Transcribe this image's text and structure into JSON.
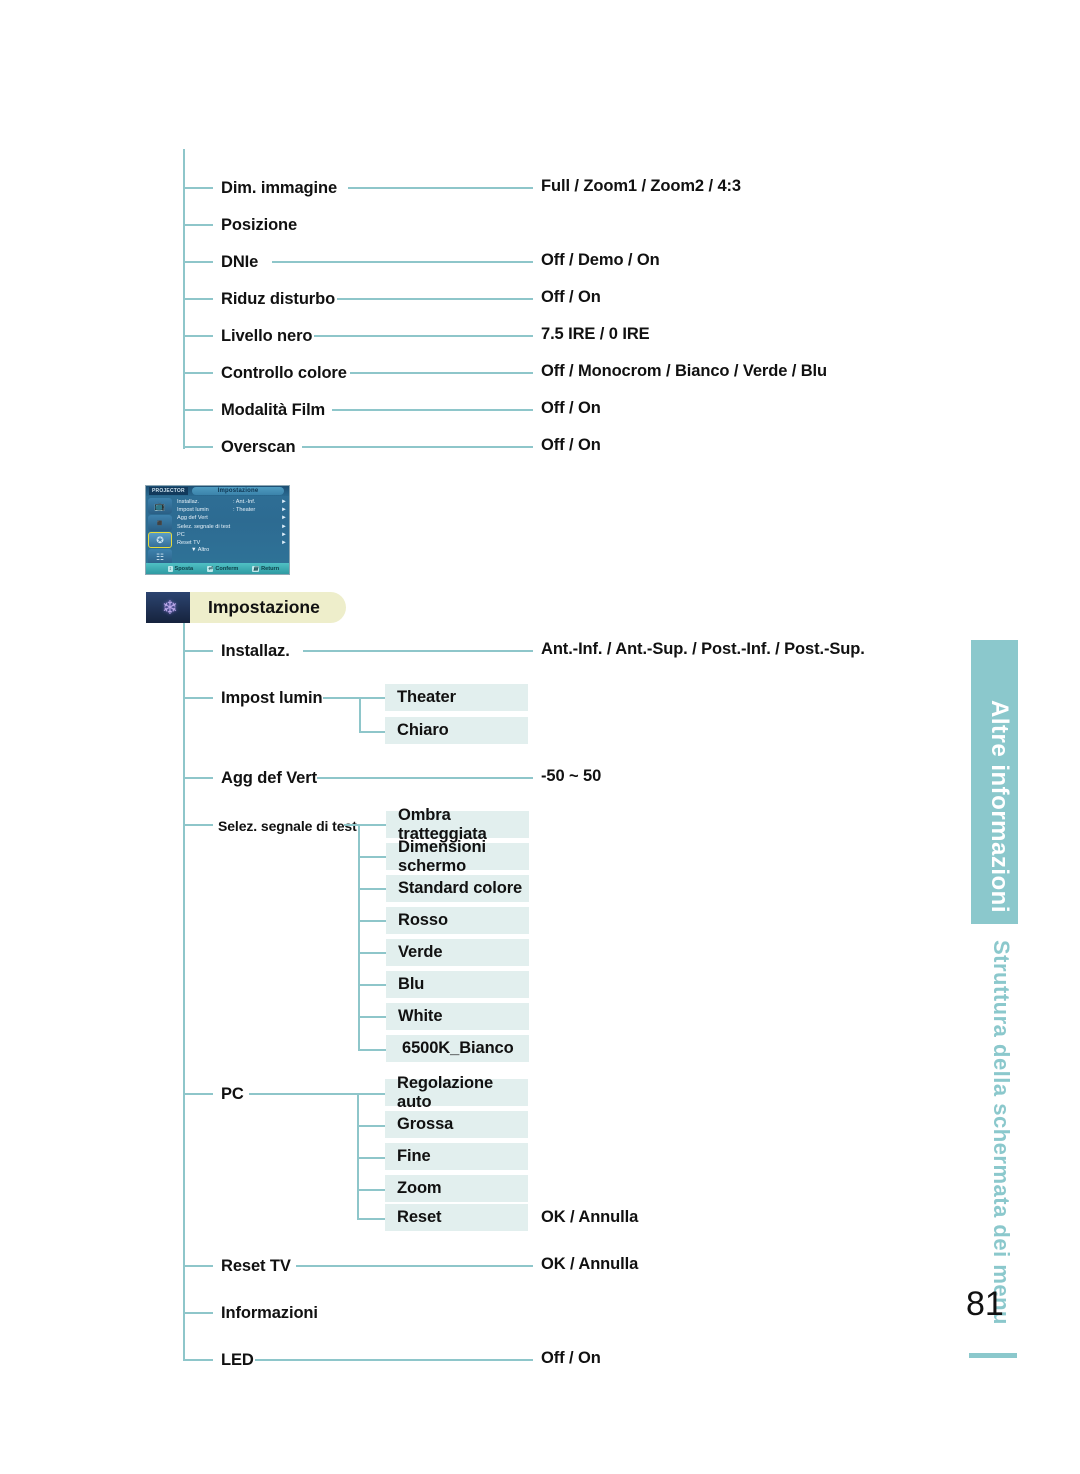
{
  "page": {
    "number": "81",
    "rail_label_white": "Altre informazioni",
    "rail_label_teal": "Struttura della schermata dei menu"
  },
  "colors": {
    "tree_line": "#8ec6ca",
    "chip_bg": "#e2efee",
    "rail": "#8bc8cc",
    "badge_bg": "#eeeecb"
  },
  "picture_menu": {
    "items": [
      {
        "label": "Dim. immagine",
        "value": "Full / Zoom1 / Zoom2 / 4:3"
      },
      {
        "label": "Posizione",
        "value": ""
      },
      {
        "label": "DNIe",
        "value": "Off / Demo / On"
      },
      {
        "label": "Riduz disturbo",
        "value": "Off / On"
      },
      {
        "label": "Livello nero",
        "value": "7.5 IRE / 0 IRE"
      },
      {
        "label": "Controllo colore",
        "value": "Off / Monocrom / Bianco / Verde / Blu"
      },
      {
        "label": "Modalità Film",
        "value": "Off / On"
      },
      {
        "label": "Overscan",
        "value": "Off / On"
      }
    ]
  },
  "osd_screenshot": {
    "brand": "PROJECTOR",
    "title": "Impostazione",
    "rows": [
      {
        "name": "Installaz.",
        "value": ": Ant.-Inf.",
        "arrow": "►"
      },
      {
        "name": "Impost lumin",
        "value": ": Theater",
        "arrow": "►"
      },
      {
        "name": "Agg def Vert",
        "value": "",
        "arrow": "►"
      },
      {
        "name": "Selez. segnale di test",
        "value": "",
        "arrow": "►"
      },
      {
        "name": "PC",
        "value": "",
        "arrow": "►"
      },
      {
        "name": "Reset TV",
        "value": "",
        "arrow": "►"
      }
    ],
    "more": "▼ Altro",
    "footer": {
      "move": "Sposta",
      "confirm": "Conferm",
      "return": "Return"
    }
  },
  "setup_section": {
    "badge_label": "Impostazione",
    "badge_icon": "setup-icon",
    "items": [
      {
        "label": "Installaz.",
        "value": "Ant.-Inf. / Ant.-Sup. / Post.-Inf. / Post.-Sup."
      },
      {
        "label": "Impost lumin",
        "value": ""
      },
      {
        "label": "Agg def Vert",
        "value": "-50 ~ 50"
      },
      {
        "label": "Selez. segnale di test",
        "value": ""
      },
      {
        "label": "PC",
        "value": ""
      },
      {
        "label": "Reset TV",
        "value": "OK / Annulla"
      },
      {
        "label": "Informazioni",
        "value": ""
      },
      {
        "label": "LED",
        "value": "Off / On"
      }
    ],
    "impost_lumin_options": [
      {
        "label": "Theater"
      },
      {
        "label": "Chiaro"
      }
    ],
    "test_signal_options": [
      {
        "label": "Ombra tratteggiata"
      },
      {
        "label": "Dimensioni schermo"
      },
      {
        "label": "Standard colore"
      },
      {
        "label": "Rosso"
      },
      {
        "label": "Verde"
      },
      {
        "label": "Blu"
      },
      {
        "label": "White"
      },
      {
        "label": "6500K_Bianco"
      }
    ],
    "pc_options": [
      {
        "label": "Regolazione auto",
        "value": ""
      },
      {
        "label": "Grossa",
        "value": ""
      },
      {
        "label": "Fine",
        "value": ""
      },
      {
        "label": "Zoom",
        "value": ""
      },
      {
        "label": "Reset",
        "value": "OK / Annulla"
      }
    ]
  }
}
